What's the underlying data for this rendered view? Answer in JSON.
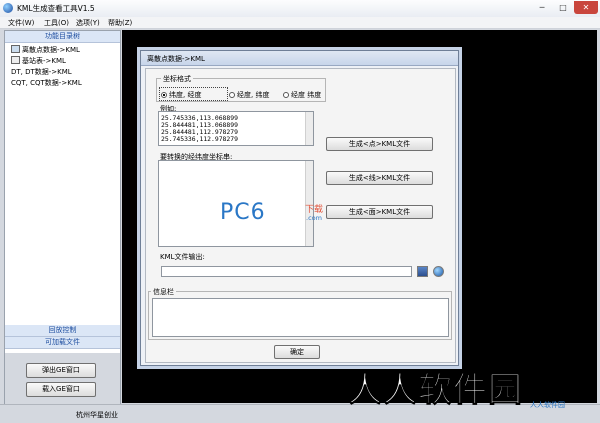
{
  "window": {
    "title": "KML生成查看工具V1.5"
  },
  "menu": [
    "文件(W)",
    "工具(O)",
    "选项(Y)",
    "帮助(Z)"
  ],
  "left_panel": {
    "header": "功能目录树",
    "tree": [
      "离散点数据->KML",
      "基站表->KML",
      "DT, DT数据->KML",
      "CQT, CQT数据->KML"
    ],
    "footer_tabs": [
      "回放控制",
      "可加载文件"
    ],
    "buttons": [
      "弹出GE窗口",
      "载入GE窗口"
    ]
  },
  "status_bar": {
    "text": "杭州华星创业"
  },
  "dialog": {
    "title": "离散点数据->KML",
    "coord_group": {
      "legend": "坐标格式",
      "options": [
        "纬度, 经度",
        "经度, 纬度",
        "经度 纬度"
      ],
      "selected_index": 0
    },
    "example_label": "例如:",
    "example_lines": [
      "25.745336,113.068899",
      "25.844481,113.068899",
      "25.844481,112.978279",
      "25.745336,112.978279"
    ],
    "input_label": "要转换的经纬度坐标串:",
    "actions": [
      "生成<点>KML文件",
      "生成<线>KML文件",
      "生成<面>KML文件"
    ],
    "output_label": "KML文件输出:",
    "output_value": "",
    "info_label": "信息栏",
    "ok_label": "确定"
  },
  "watermarks": {
    "pc6": "PC6",
    "pc6_download": "下载",
    "pc6_domain": ".com",
    "site_cn": "人人软件园",
    "logo_small": "人人软件园"
  }
}
